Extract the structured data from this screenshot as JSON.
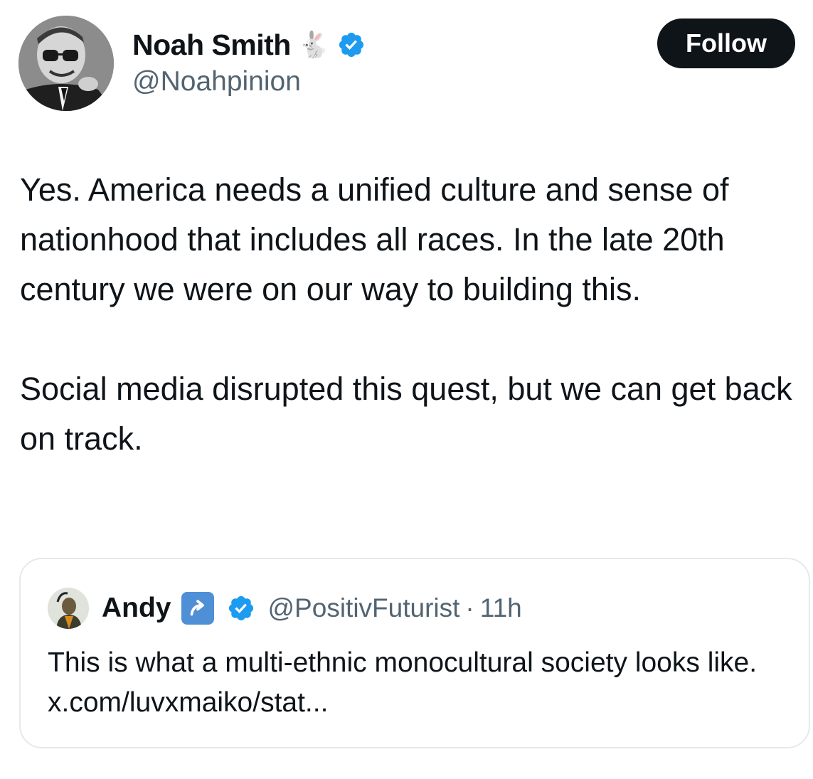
{
  "author": {
    "name": "Noah Smith",
    "emoji": "🐇",
    "verified_icon": "verified-badge-icon",
    "handle": "@Noahpinion"
  },
  "follow_button": {
    "label": "Follow"
  },
  "tweet": {
    "paragraphs": [
      "Yes. America needs a unified culture and sense of nationhood that includes all races. In the late 20th century we were on our way to building this.",
      "Social media disrupted this quest, but we can get back on track."
    ]
  },
  "quoted_tweet": {
    "name": "Andy",
    "badge_icon": "up-arrow-badge-icon",
    "verified_icon": "verified-badge-icon",
    "handle": "@PositivFuturist",
    "separator": "·",
    "time": "11h",
    "text": "This is what a multi-ethnic monocultural society looks like. x.com/luvxmaiko/stat..."
  },
  "colors": {
    "text_primary": "#0f1419",
    "text_secondary": "#536471",
    "verified_blue": "#1d9bf0",
    "follow_bg": "#0f1419",
    "card_border": "#e6e9eb"
  }
}
